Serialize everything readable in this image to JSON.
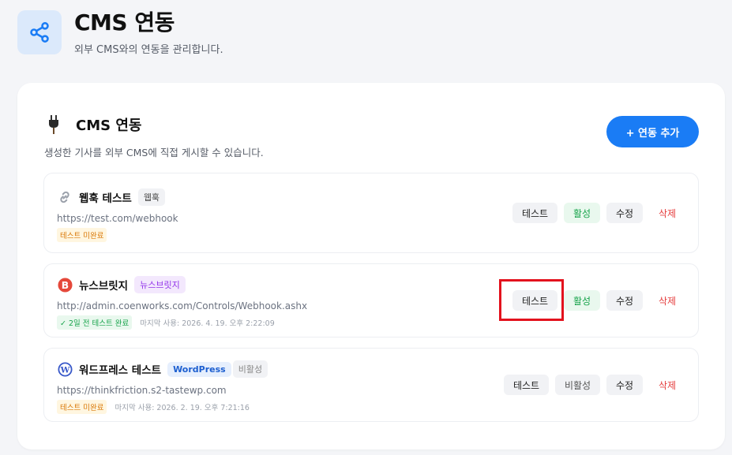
{
  "header": {
    "title": "CMS 연동",
    "subtitle": "외부 CMS와의 연동을 관리합니다.",
    "icon": "share-icon"
  },
  "card": {
    "title": "CMS 연동",
    "subtitle": "생성한 기사를 외부 CMS에 직접 게시할 수 있습니다.",
    "icon": "plug-icon",
    "add_button": "+ 연동 추가"
  },
  "integrations": [
    {
      "name": "웹훅 테스트",
      "type": "웹훅",
      "icon": "link-icon",
      "url": "https://test.com/webhook",
      "status": "테스트 미완료",
      "last_used": "",
      "actions": {
        "test": "테스트",
        "toggle": "활성",
        "edit": "수정",
        "delete": "삭제"
      }
    },
    {
      "name": "뉴스브릿지",
      "type": "뉴스브릿지",
      "icon": "newsbridge-icon",
      "url": "http://admin.coenworks.com/Controls/Webhook.ashx",
      "status": "✓ 2일 전 테스트 완료",
      "last_used": "마지막 사용: 2026. 4. 19. 오후 2:22:09",
      "actions": {
        "test": "테스트",
        "toggle": "활성",
        "edit": "수정",
        "delete": "삭제"
      }
    },
    {
      "name": "워드프레스 테스트",
      "type": "WordPress",
      "state_badge": "비활성",
      "icon": "wordpress-icon",
      "url": "https://thinkfriction.s2-tastewp.com",
      "status": "테스트 미완료",
      "last_used": "마지막 사용: 2026. 2. 19. 오후 7:21:16",
      "actions": {
        "test": "테스트",
        "toggle": "비활성",
        "edit": "수정",
        "delete": "삭제"
      }
    }
  ],
  "colors": {
    "accent": "#1a7cf5",
    "success": "#16a34a",
    "danger": "#e53e3e",
    "warning": "#d97706",
    "highlight": "#e3121d"
  }
}
